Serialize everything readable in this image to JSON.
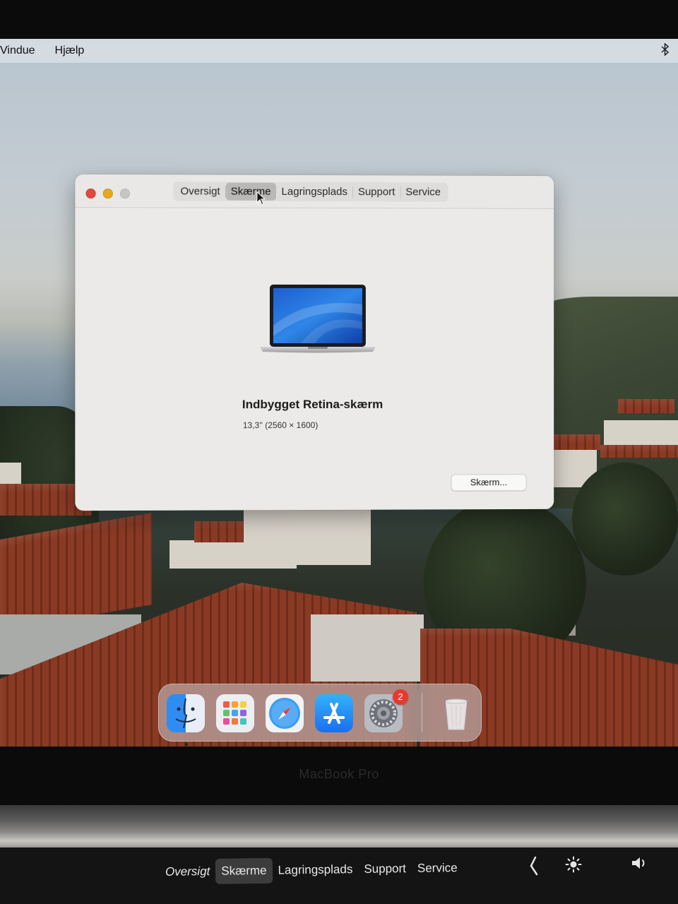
{
  "menubar": {
    "items": [
      "Vindue",
      "Hjælp"
    ],
    "right_icon": "bluetooth-icon"
  },
  "window": {
    "tabs": [
      {
        "label": "Oversigt",
        "active": false
      },
      {
        "label": "Skærme",
        "active": true
      },
      {
        "label": "Lagringsplads",
        "active": false
      },
      {
        "label": "Support",
        "active": false
      },
      {
        "label": "Service",
        "active": false
      }
    ],
    "display": {
      "name": "Indbygget Retina-skærm",
      "resolution": "13,3'' (2560 × 1600)"
    },
    "button_label": "Skærm..."
  },
  "dock": {
    "apps": [
      {
        "name": "finder-icon"
      },
      {
        "name": "launchpad-icon"
      },
      {
        "name": "safari-icon"
      },
      {
        "name": "app-store-icon"
      },
      {
        "name": "system-preferences-icon",
        "badge": "2"
      },
      {
        "name": "trash-icon"
      }
    ]
  },
  "bezel": {
    "label": "MacBook Pro"
  },
  "touchbar": {
    "items": [
      {
        "label": "Oversigt",
        "active": false
      },
      {
        "label": "Skærme",
        "active": true
      },
      {
        "label": "Lagringsplads",
        "active": false
      },
      {
        "label": "Support",
        "active": false
      },
      {
        "label": "Service",
        "active": false
      }
    ],
    "icons": [
      "chevron-left-icon",
      "brightness-icon",
      "volume-icon"
    ]
  },
  "colors": {
    "close": "#e24a3d",
    "minimize": "#e6a81f",
    "badge": "#e8392f"
  }
}
